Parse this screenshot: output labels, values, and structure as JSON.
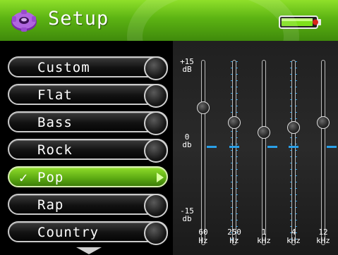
{
  "header": {
    "title": "Setup",
    "icon": "gear-icon",
    "battery_icon": "battery-icon",
    "accent_color": "#5cb313"
  },
  "presets": [
    {
      "label": "Custom",
      "selected": false
    },
    {
      "label": "Flat",
      "selected": false
    },
    {
      "label": "Bass",
      "selected": false
    },
    {
      "label": "Rock",
      "selected": false
    },
    {
      "label": "Pop",
      "selected": true,
      "check": "✓"
    },
    {
      "label": "Rap",
      "selected": false
    },
    {
      "label": "Country",
      "selected": false
    }
  ],
  "scroll_down_icon": "chevron-down-icon",
  "equalizer": {
    "scale_top": {
      "value": "+15",
      "unit": "dB"
    },
    "scale_mid": {
      "value": "0",
      "unit": "db"
    },
    "scale_bottom": {
      "value": "-15",
      "unit": "db"
    },
    "bands": [
      {
        "freq": "60",
        "unit": "Hz",
        "gain_db": 7
      },
      {
        "freq": "250",
        "unit": "Hz",
        "gain_db": 4
      },
      {
        "freq": "1",
        "unit": "kHz",
        "gain_db": 2
      },
      {
        "freq": "4",
        "unit": "kHz",
        "gain_db": 3
      },
      {
        "freq": "12",
        "unit": "kHz",
        "gain_db": 4
      }
    ],
    "min_db": -15,
    "max_db": 15,
    "marker_color": "#2aa0e8"
  }
}
